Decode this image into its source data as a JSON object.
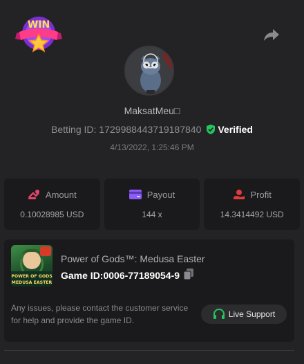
{
  "header": {
    "badge_text": "WIN",
    "badge_icon": "win-badge-icon",
    "share_icon": "share-icon"
  },
  "player": {
    "username": "MaksatMeu□",
    "betting_id_label": "Betting ID:",
    "betting_id": "1729988443719187840",
    "verified_label": "Verified",
    "date": "4/13/2022, 1:25:46 PM"
  },
  "stats": [
    {
      "label": "Amount",
      "value": "0.10028985 USD",
      "icon": "amount-icon"
    },
    {
      "label": "Payout",
      "value": "144 x",
      "icon": "payout-icon"
    },
    {
      "label": "Profit",
      "value": "14.3414492 USD",
      "icon": "profit-icon"
    }
  ],
  "game": {
    "title": "Power of Gods™: Medusa Easter",
    "id_label": "Game ID:",
    "id": "0006-77189054-9",
    "thumb_text_1": "POWER OF GODS",
    "thumb_text_2": "MEDUSA EASTER"
  },
  "support": {
    "message": "Any issues, please contact the customer service for help and provide the game ID.",
    "button_label": "Live Support"
  },
  "colors": {
    "background": "#232325",
    "card": "#1a1a1c",
    "verified_green": "#22c55e",
    "amount_pink": "#e2466a",
    "payout_purple": "#8b5cf6",
    "profit_red": "#e23b3b"
  }
}
